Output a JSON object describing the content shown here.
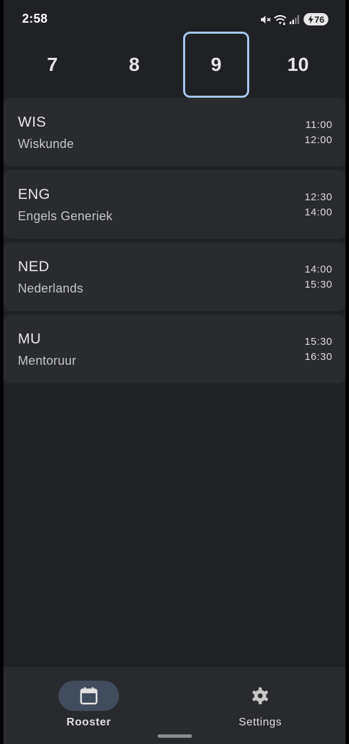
{
  "status_bar": {
    "time": "2:58",
    "battery_level": "76",
    "icons": [
      "mute-icon",
      "wifi-icon",
      "signal-icon",
      "battery-charging-icon"
    ]
  },
  "days": [
    {
      "label": "7",
      "selected": false
    },
    {
      "label": "8",
      "selected": false
    },
    {
      "label": "9",
      "selected": true
    },
    {
      "label": "10",
      "selected": false
    }
  ],
  "lessons": [
    {
      "code": "WIS",
      "name": "Wiskunde",
      "start": "11:00",
      "end": "12:00"
    },
    {
      "code": "ENG",
      "name": "Engels Generiek",
      "start": "12:30",
      "end": "14:00"
    },
    {
      "code": "NED",
      "name": "Nederlands",
      "start": "14:00",
      "end": "15:30"
    },
    {
      "code": "MU",
      "name": "Mentoruur",
      "start": "15:30",
      "end": "16:30"
    }
  ],
  "bottom_nav": {
    "items": [
      {
        "label": "Rooster",
        "icon": "calendar-icon",
        "active": true
      },
      {
        "label": "Settings",
        "icon": "gear-icon",
        "active": false
      }
    ]
  },
  "colors": {
    "background": "#202124",
    "card": "#2a2b2e",
    "selected_border": "#a8c7f0",
    "nav_background": "#292a2d",
    "active_pill": "#414c5c"
  }
}
